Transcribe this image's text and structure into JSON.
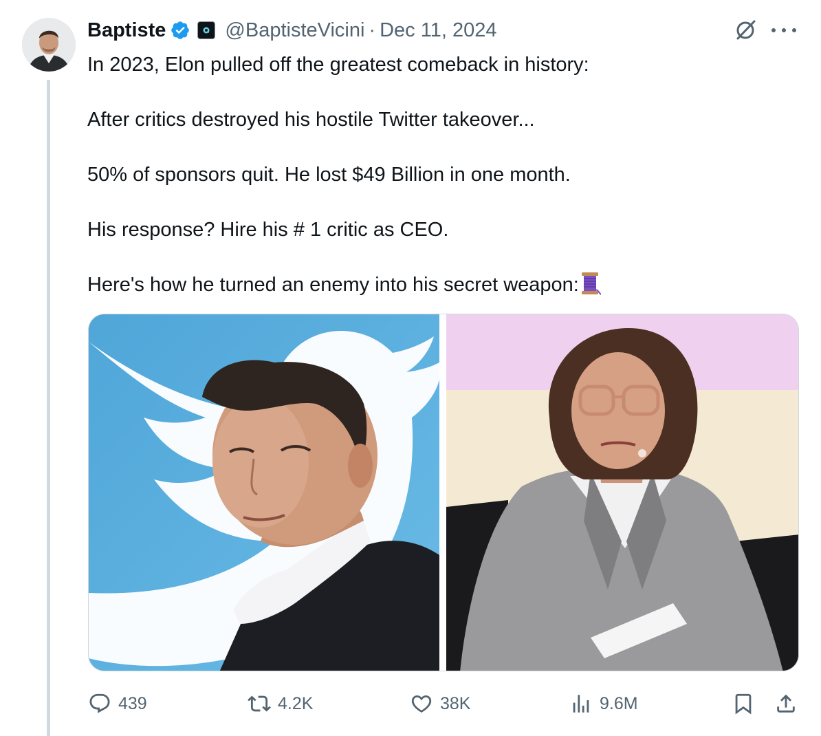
{
  "author": {
    "name": "Baptiste",
    "handle": "@BaptisteVicini",
    "separator": "·",
    "date": "Dec 11, 2024",
    "verified": true,
    "affiliate_badge_icon": "affiliate-badge-icon"
  },
  "tweet": {
    "lines": [
      "In 2023, Elon pulled off the greatest comeback in history:",
      "",
      "After critics destroyed his hostile Twitter takeover...",
      "",
      "50% of sponsors quit. He lost $49 Billion in one month.",
      "",
      "His response? Hire his # 1 critic as CEO.",
      "",
      "Here's how he turned an enemy into his secret weapon:"
    ],
    "trailing_emoji": "spool-of-thread-icon"
  },
  "media": {
    "left_image": "photo-man-with-bird-logo",
    "right_image": "photo-woman-in-gray-suit"
  },
  "metrics": {
    "replies": "439",
    "reposts": "4.2K",
    "likes": "38K",
    "views": "9.6M"
  },
  "colors": {
    "verified_blue": "#1d9bf0",
    "text_primary": "#0f1419",
    "text_secondary": "#536471",
    "divider": "#cfd9de",
    "twitter_blue_bg": "#5aaede"
  }
}
